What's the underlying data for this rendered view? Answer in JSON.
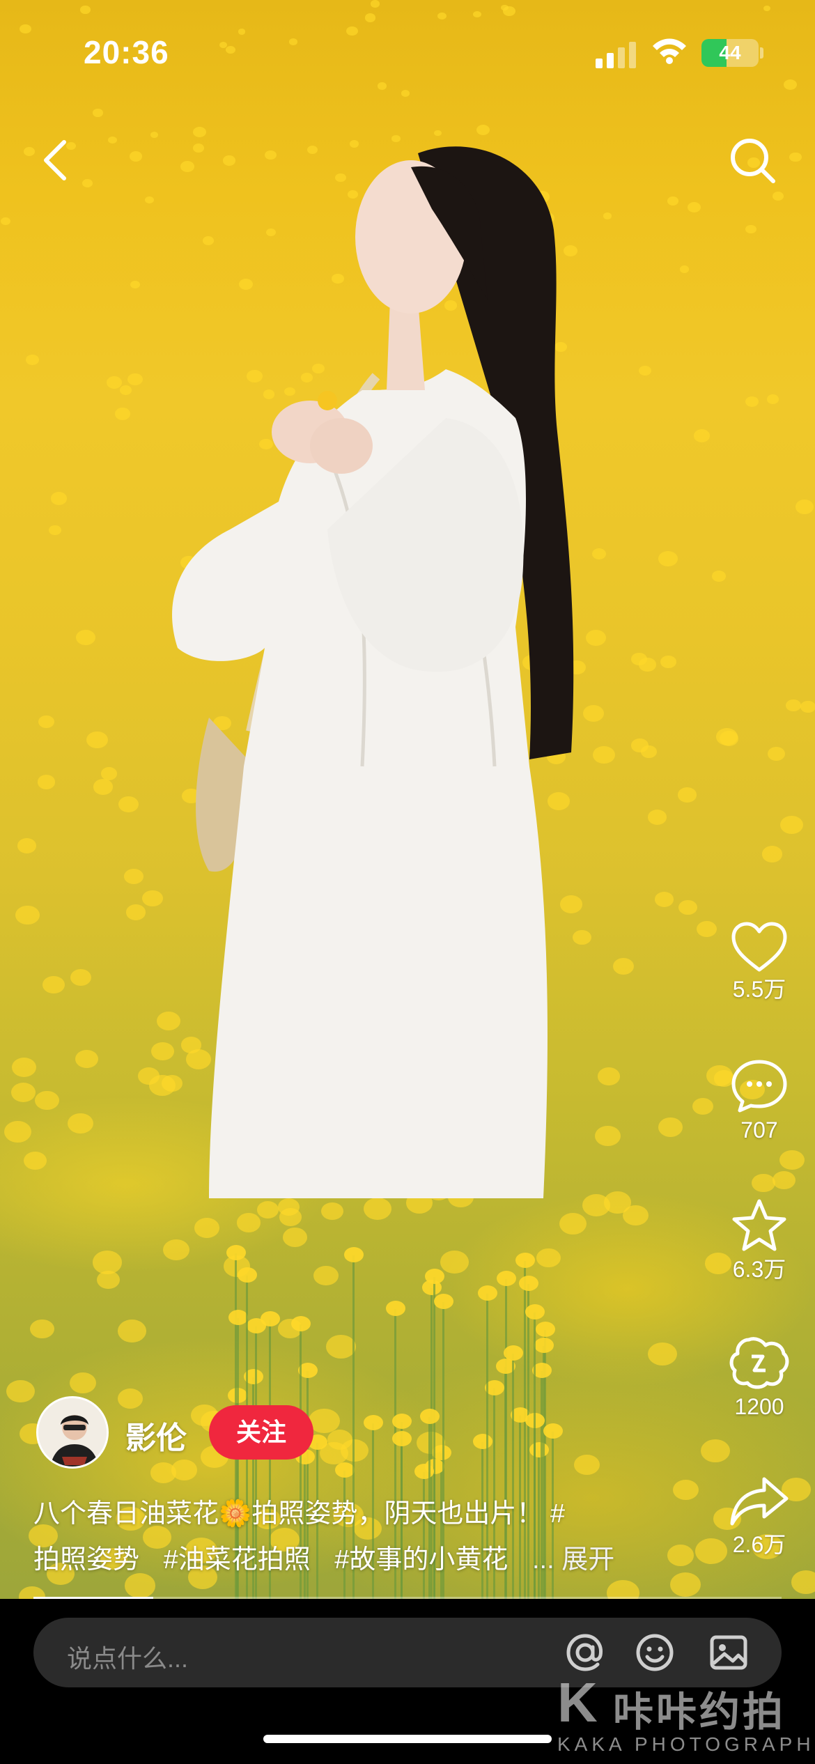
{
  "status_bar": {
    "time": "20:36",
    "battery_level": "44",
    "battery_fraction": 0.44
  },
  "nav": {
    "back_icon": "chevron-left-icon",
    "search_icon": "search-icon"
  },
  "actions": {
    "like_count": "5.5万",
    "comment_count": "707",
    "favorite_count": "6.3万",
    "remix_count": "1200",
    "share_count": "2.6万"
  },
  "author": {
    "name": "影伦",
    "follow_label": "关注"
  },
  "caption": {
    "line1": "八个春日油菜花🌼拍照姿势，阴天也出片！ #",
    "tags": [
      "拍照姿势",
      "#油菜花拍照",
      "#故事的小黄花"
    ],
    "more": "... 展开"
  },
  "progress": {
    "fraction": 0.16
  },
  "comment_bar": {
    "placeholder": "说点什么..."
  },
  "watermark": {
    "letter": "K",
    "title": "咔咔约拍",
    "subtitle": "KAKA PHOTOGRAPH"
  },
  "colors": {
    "follow_button": "#f0273e",
    "battery_fill": "#30c759",
    "field_yellow": "#efc21e"
  }
}
